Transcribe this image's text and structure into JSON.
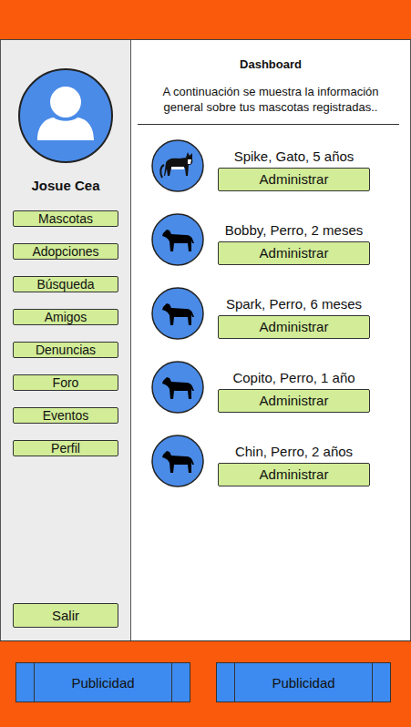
{
  "sidebar": {
    "user": "Josue Cea",
    "items": [
      "Mascotas",
      "Adopciones",
      "Búsqueda",
      "Amigos",
      "Denuncias",
      "Foro",
      "Eventos",
      "Perfil"
    ],
    "logout": "Salir"
  },
  "dashboard": {
    "title": "Dashboard",
    "description": "A continuación se muestra la información general sobre tus mascotas registradas..",
    "pets": [
      {
        "label": "Spike, Gato, 5 años",
        "kind": "cat",
        "button": "Administrar"
      },
      {
        "label": "Bobby, Perro, 2 meses",
        "kind": "dog",
        "button": "Administrar"
      },
      {
        "label": "Spark, Perro, 6 meses",
        "kind": "dog",
        "button": "Administrar"
      },
      {
        "label": "Copito, Perro, 1 año",
        "kind": "dog",
        "button": "Administrar"
      },
      {
        "label": "Chin, Perro, 2 años",
        "kind": "dog",
        "button": "Administrar"
      }
    ]
  },
  "footer": {
    "ads": [
      "Publicidad",
      "Publicidad"
    ]
  }
}
